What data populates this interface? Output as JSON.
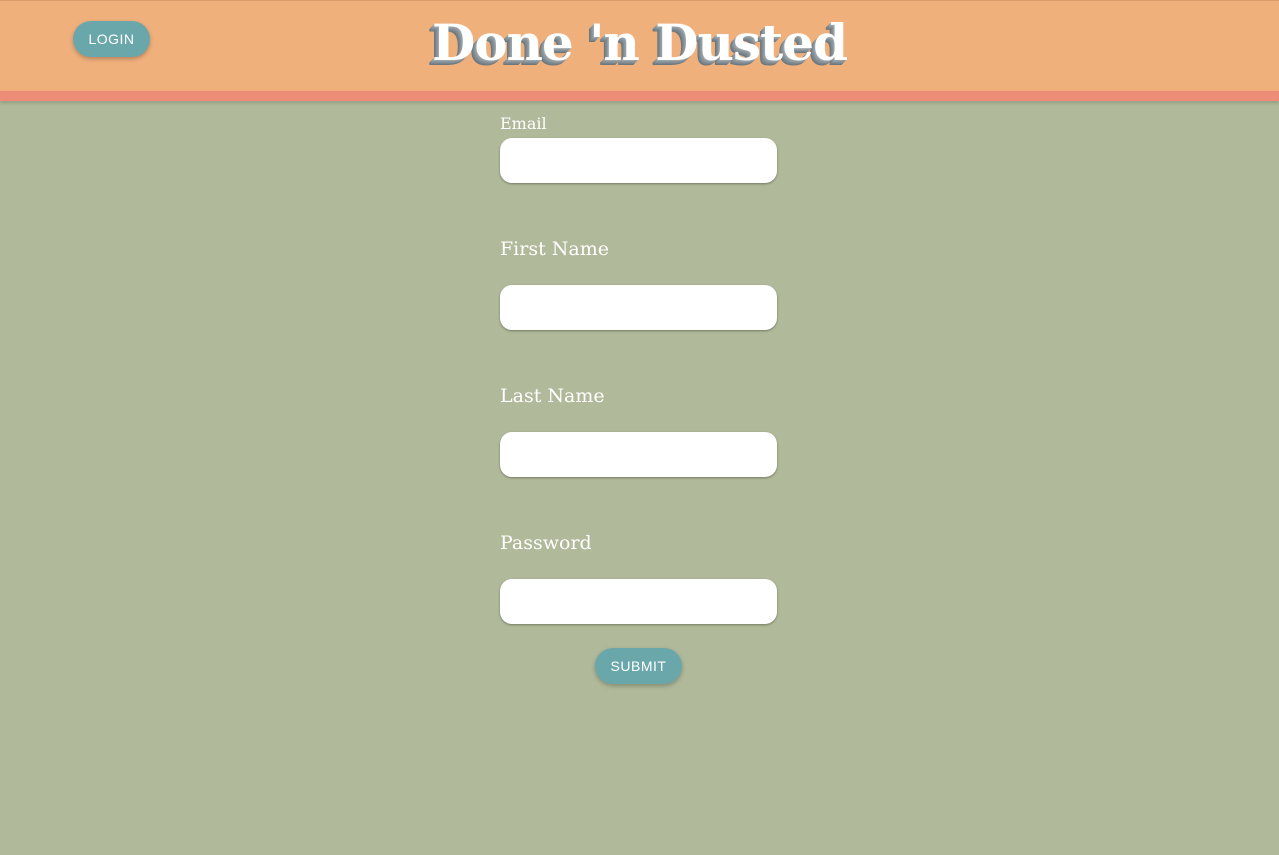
{
  "header": {
    "title": "Done 'n Dusted",
    "login_label": "LOGIN"
  },
  "form": {
    "email_label": "Email",
    "email_value": "",
    "first_name_label": "First Name",
    "first_name_value": "",
    "last_name_label": "Last Name",
    "last_name_value": "",
    "password_label": "Password",
    "password_value": "",
    "submit_label": "SUBMIT"
  },
  "colors": {
    "header_background": "#f0b07c",
    "header_stripe": "#ed8d78",
    "page_background": "#b0b99a",
    "button_background": "#6aa7ab",
    "text_light": "#ffffff"
  }
}
